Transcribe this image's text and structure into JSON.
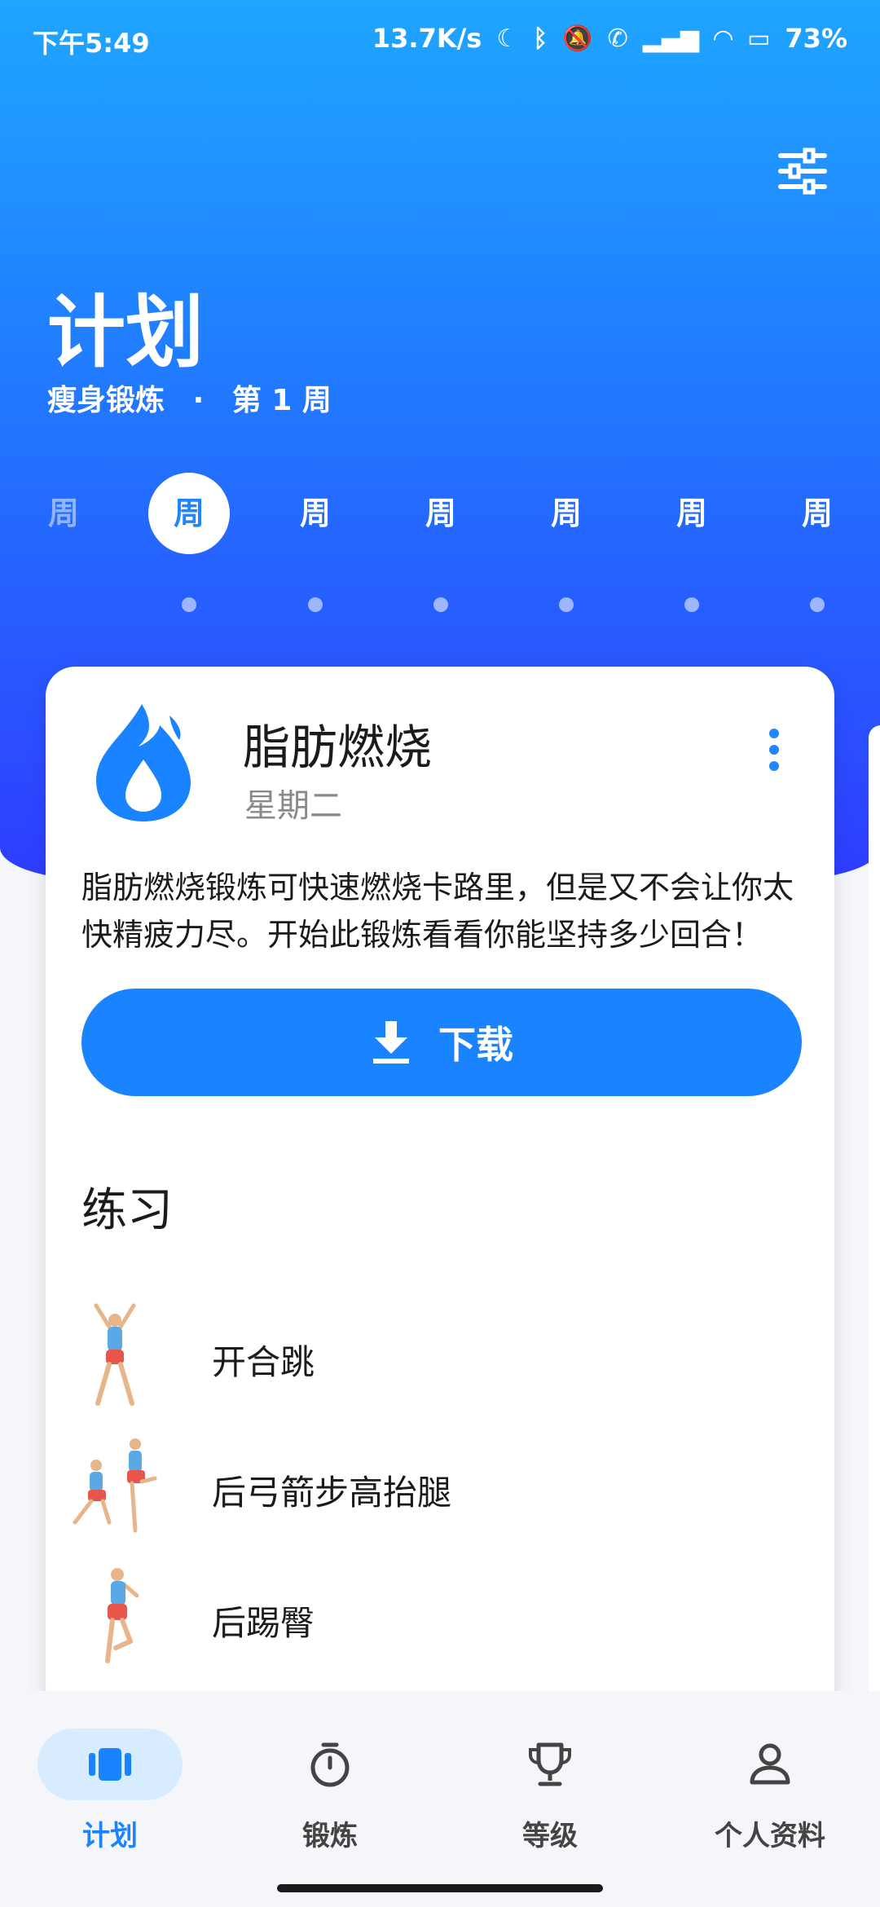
{
  "status_bar": {
    "time": "下午5:49",
    "network_speed": "13.7K/s",
    "battery": "73%"
  },
  "header": {
    "title": "计划",
    "plan_name": "瘦身锻炼",
    "separator": "·",
    "week_label": "第 1 周"
  },
  "week_tabs": [
    "周",
    "周",
    "周",
    "周",
    "周",
    "周",
    "周"
  ],
  "workout_card": {
    "title": "脂肪燃烧",
    "day": "星期二",
    "description": "脂肪燃烧锻炼可快速燃烧卡路里，但是又不会让你太快精疲力尽。开始此锻炼看看你能坚持多少回合！",
    "download_label": "下载",
    "section_title": "练习",
    "exercises": [
      {
        "name": "开合跳"
      },
      {
        "name": "后弓箭步高抬腿"
      },
      {
        "name": "后踢臀"
      }
    ]
  },
  "bottom_nav": {
    "items": [
      {
        "label": "计划",
        "icon": "plan-icon",
        "active": true
      },
      {
        "label": "锻炼",
        "icon": "stopwatch-icon",
        "active": false
      },
      {
        "label": "等级",
        "icon": "trophy-icon",
        "active": false
      },
      {
        "label": "个人资料",
        "icon": "person-icon",
        "active": false
      }
    ]
  },
  "colors": {
    "accent": "#1a83ff",
    "header_gradient_top": "#1fa6ff",
    "header_gradient_bottom": "#2f3dff"
  }
}
